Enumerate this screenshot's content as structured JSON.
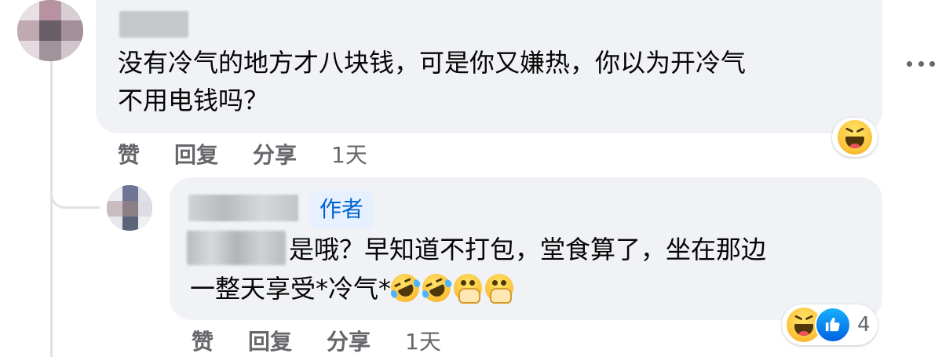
{
  "colors": {
    "bubble_bg": "#f0f2f5",
    "text_primary": "#050505",
    "text_secondary": "#65676b",
    "author_badge_bg": "#e6f0ff",
    "author_badge_text": "#0064d1",
    "like_blue": "#0866ff",
    "haha_yellow": "#fcc33a"
  },
  "comment": {
    "text_line1": "没有冷气的地方才八块钱，可是你又嫌热，你以为开冷气",
    "text_line2": "不用电钱吗？",
    "actions": {
      "like": "赞",
      "reply": "回复",
      "share": "分享",
      "time": "1天"
    },
    "reactions": [
      "haha-emoji"
    ]
  },
  "reply": {
    "author_badge": "作者",
    "text_line1": "是哦？早知道不打包，堂食算了，坐在那边",
    "text_line2": "一整天享受*冷气*",
    "inline_emojis": [
      "rofl-emoji",
      "rofl-emoji",
      "hand-over-mouth-emoji",
      "hand-over-mouth-emoji"
    ],
    "actions": {
      "like": "赞",
      "reply": "回复",
      "share": "分享",
      "time": "1天"
    },
    "reactions": [
      "haha-emoji",
      "like-emoji"
    ],
    "reaction_count": "4"
  }
}
